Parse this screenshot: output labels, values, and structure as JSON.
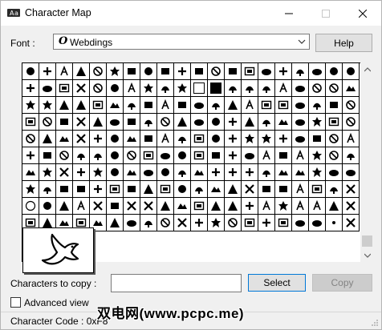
{
  "window": {
    "title": "Character Map",
    "app_icon": "character-map-icon",
    "controls": [
      "minimize-icon",
      "maximize-icon",
      "close-icon"
    ]
  },
  "font": {
    "label": "Font :",
    "selected": "Webdings",
    "icon": "opentype-font-icon"
  },
  "help_label": "Help",
  "grid": {
    "columns": 20,
    "visible_rows": 10,
    "zoomed_glyph": "dove-icon",
    "glyphs": [
      [
        "spider",
        "web",
        "sunglasses",
        "ear",
        "crowd",
        "crown",
        "landscape",
        "eye",
        "mountain-trees",
        "house-trees",
        "city-block",
        "church",
        "right-skip",
        "left-skip",
        "satellite",
        "plus-skip",
        "lock",
        "heart",
        "broken-heart",
        "speaker"
      ],
      [
        "speech-bubble",
        "cloud-speech",
        "islands",
        "pin",
        "parachute",
        "lamp",
        "ribbon",
        "checkmark",
        "bus",
        "bicycle",
        "blank-square",
        "filled-square",
        "gift",
        "car-front",
        "truck",
        "bus-front",
        "square-box",
        "megaphone",
        "loud",
        "plane-takeoff"
      ],
      [
        "plane",
        "runway",
        "aircraft",
        "helicopter",
        "compass",
        "ship",
        "landmark",
        "seat",
        "sailboat",
        "statue",
        "woman",
        "man",
        "sun-disc",
        "arrow-right",
        "arrow-left",
        "arrow-up",
        "arrow-down",
        "ship-front",
        "rocket",
        "shield"
      ],
      [
        "brackets",
        "x-mark",
        "question",
        "right-bracket",
        "receipt",
        "bench",
        "card",
        "lights",
        "no-entry",
        "circle-bar",
        "circle-slash",
        "no-smoking",
        "ambulance",
        "starburst",
        "starburst-2",
        "lightning",
        "signpost",
        "person",
        "plane-side",
        "person-standing"
      ],
      [
        "alien",
        "cocktail",
        "skateboarder",
        "walker",
        "surfer",
        "skier",
        "bowling",
        "basketball",
        "rider",
        "sprinter",
        "tennis",
        "snowman",
        "runner",
        "money-bag",
        "sheep",
        "bull",
        "fish",
        "lips",
        "face",
        "star"
      ],
      [
        "picture",
        "documents",
        "tablet",
        "document",
        "clapper",
        "filmstrip",
        "film-reel",
        "house",
        "eye-side",
        "hanger",
        "film",
        "notepad",
        "calendar",
        "cards",
        "screen",
        "bookshelf",
        "book",
        "tray",
        "chair",
        "camera"
      ],
      [
        "image-frame",
        "theater-mask",
        "typewriter",
        "bottle",
        "tape",
        "headphones",
        "cassette",
        "microphone",
        "gramophone",
        "cd",
        "keyboard",
        "tv",
        "video",
        "radio",
        "speaker-box",
        "bandage",
        "briefcase",
        "monitor",
        "computer",
        "printer"
      ],
      [
        "rocket-car",
        "network",
        "joystick",
        "telephone",
        "phone",
        "fax",
        "keypad",
        "computer-room",
        "envelope",
        "folder",
        "package",
        "disk",
        "document-lines",
        "lockbox",
        "padlock",
        "key",
        "chip",
        "inbox",
        "sewing",
        "fire"
      ],
      [
        "circle",
        "cloud",
        "cloud-rain",
        "cloud-storm",
        "cloud-sun",
        "rain",
        "snow",
        "lightning-cloud",
        "tornado",
        "fog",
        "wind",
        "moon",
        "thermometer",
        "beach",
        "drink",
        "cup",
        "shelter",
        "stop",
        "fountain",
        "parking"
      ],
      [
        "dove",
        "hash-lines",
        "bubbles",
        "plane-side",
        "feather",
        "mouse",
        "cat",
        "fox",
        "rabbit",
        "fish-2",
        "skeleton",
        "globe",
        "butterfly",
        "fairy",
        "tree",
        "cross",
        "tower",
        "pin-2",
        "dot",
        "earth"
      ]
    ]
  },
  "copy": {
    "label": "Characters to copy :",
    "value": "",
    "select_label": "Select",
    "copy_label": "Copy"
  },
  "advanced": {
    "label": "Advanced view",
    "checked": false
  },
  "status": {
    "text": "Character Code : 0xF8"
  },
  "watermark": "双电网(www.pcpc.me)"
}
